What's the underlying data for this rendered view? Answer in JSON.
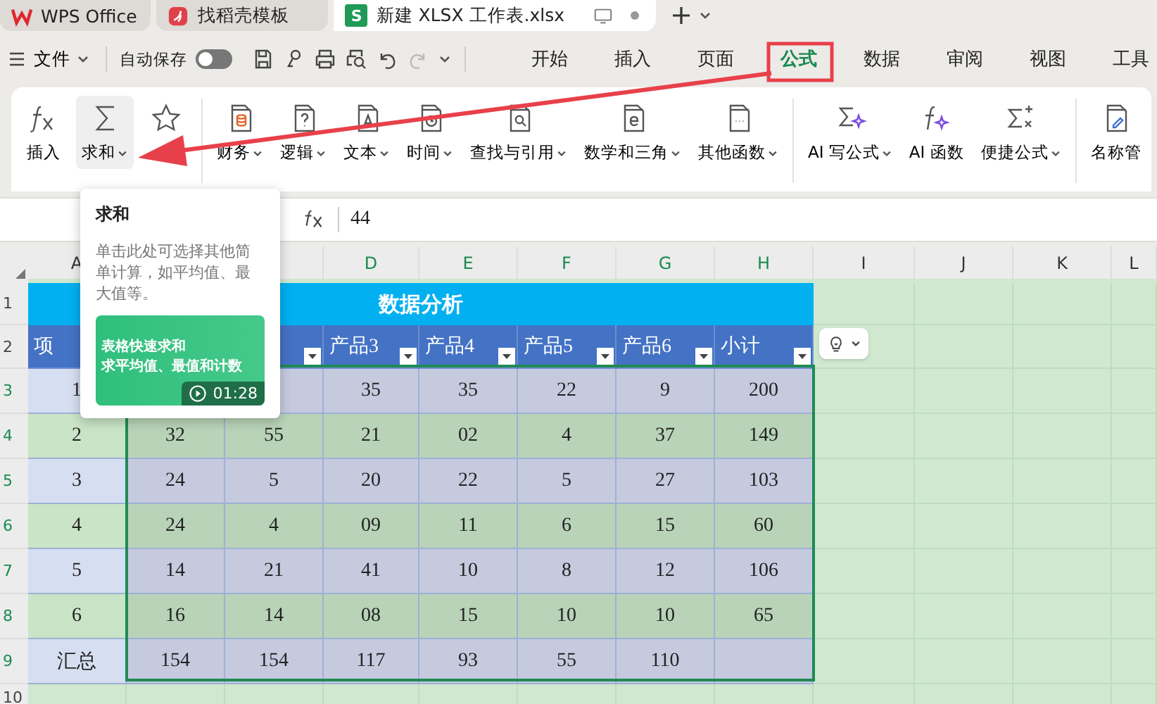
{
  "title_tabs": [
    {
      "label": "WPS Office",
      "selected": false
    },
    {
      "label": "找稻壳模板",
      "selected": false
    },
    {
      "label": "新建 XLSX 工作表.xlsx",
      "logo": "S",
      "selected": true
    }
  ],
  "menu": {
    "file": "文件",
    "autosave": {
      "label": "自动保存",
      "on": false
    },
    "tabs": [
      {
        "label": "开始",
        "selected": false
      },
      {
        "label": "插入",
        "selected": false
      },
      {
        "label": "页面",
        "selected": false
      },
      {
        "label": "公式",
        "selected": true
      },
      {
        "label": "数据",
        "selected": false
      },
      {
        "label": "审阅",
        "selected": false
      },
      {
        "label": "视图",
        "selected": false
      },
      {
        "label": "工具",
        "selected": false
      }
    ]
  },
  "ribbon": {
    "groups": [
      [
        {
          "label": "插入",
          "dropdown": false,
          "hovered": false
        },
        {
          "label": "求和",
          "dropdown": true,
          "hovered": true
        },
        {
          "hovered": false
        }
      ],
      [
        {
          "label": "财务",
          "dropdown": true,
          "hovered": false
        },
        {
          "label": "逻辑",
          "dropdown": true,
          "hovered": false
        },
        {
          "label": "文本",
          "dropdown": true,
          "hovered": false
        },
        {
          "label": "时间",
          "dropdown": true,
          "hovered": false
        },
        {
          "label": "查找与引用",
          "dropdown": true,
          "hovered": false
        },
        {
          "label": "数学和三角",
          "dropdown": true,
          "hovered": false
        },
        {
          "label": "其他函数",
          "dropdown": true,
          "hovered": false
        }
      ],
      [
        {
          "label": "AI 写公式",
          "dropdown": true,
          "hovered": false
        },
        {
          "label": "AI 函数",
          "dropdown": false,
          "hovered": false
        },
        {
          "label": "便捷公式",
          "dropdown": true,
          "hovered": false
        }
      ],
      [
        {
          "label": "名称管",
          "dropdown": false,
          "hovered": false
        }
      ]
    ]
  },
  "formula_bar": {
    "value": "44"
  },
  "tooltip": {
    "title": "求和",
    "text": "单击此处可选择其他简单计算，如平均值、最大值等。",
    "video": {
      "caption": [
        "表格快速求和",
        "求平均值、最值和计数"
      ],
      "duration": "01:28"
    }
  },
  "sheet": {
    "columns": [
      {
        "label": "A",
        "selected": false
      },
      null,
      null,
      {
        "label": "D",
        "selected": true
      },
      {
        "label": "E",
        "selected": true
      },
      {
        "label": "F",
        "selected": true
      },
      {
        "label": "G",
        "selected": true
      },
      {
        "label": "H",
        "selected": true
      },
      {
        "label": "I",
        "selected": false
      },
      {
        "label": "J",
        "selected": false
      },
      {
        "label": "K",
        "selected": false
      },
      {
        "label": "L",
        "selected": false
      }
    ],
    "rows": [
      {
        "number": {
          "label": "1",
          "selected": false
        },
        "kind": "title",
        "title": "数据分析"
      },
      {
        "number": {
          "label": "2",
          "selected": false
        },
        "kind": "header",
        "cells": [
          "项",
          null,
          null,
          "产品3",
          "产品4",
          "产品5",
          "产品6",
          "小计"
        ]
      },
      {
        "number": {
          "label": "3",
          "selected": true
        },
        "kind": "data",
        "cells": [
          "1",
          null,
          null,
          "35",
          "35",
          "22",
          "9",
          "200"
        ]
      },
      {
        "number": {
          "label": "4",
          "selected": true
        },
        "kind": "data",
        "cells": [
          "2",
          "32",
          "55",
          "21",
          "02",
          "4",
          "37",
          "149"
        ]
      },
      {
        "number": {
          "label": "5",
          "selected": true
        },
        "kind": "data",
        "cells": [
          "3",
          "24",
          "5",
          "20",
          "22",
          "5",
          "27",
          "103"
        ]
      },
      {
        "number": {
          "label": "6",
          "selected": true
        },
        "kind": "data",
        "cells": [
          "4",
          "24",
          "4",
          "09",
          "11",
          "6",
          "15",
          "60"
        ]
      },
      {
        "number": {
          "label": "7",
          "selected": true
        },
        "kind": "data",
        "cells": [
          "5",
          "14",
          "21",
          "41",
          "10",
          "8",
          "12",
          "106"
        ]
      },
      {
        "number": {
          "label": "8",
          "selected": true
        },
        "kind": "data",
        "cells": [
          "6",
          "16",
          "14",
          "08",
          "15",
          "10",
          "10",
          "65"
        ]
      },
      {
        "number": {
          "label": "9",
          "selected": true
        },
        "kind": "data",
        "cells": [
          "汇总",
          "154",
          "154",
          "117",
          "93",
          "55",
          "110",
          null
        ]
      },
      {
        "number": {
          "label": "10",
          "selected": false
        },
        "kind": "empty"
      }
    ]
  }
}
